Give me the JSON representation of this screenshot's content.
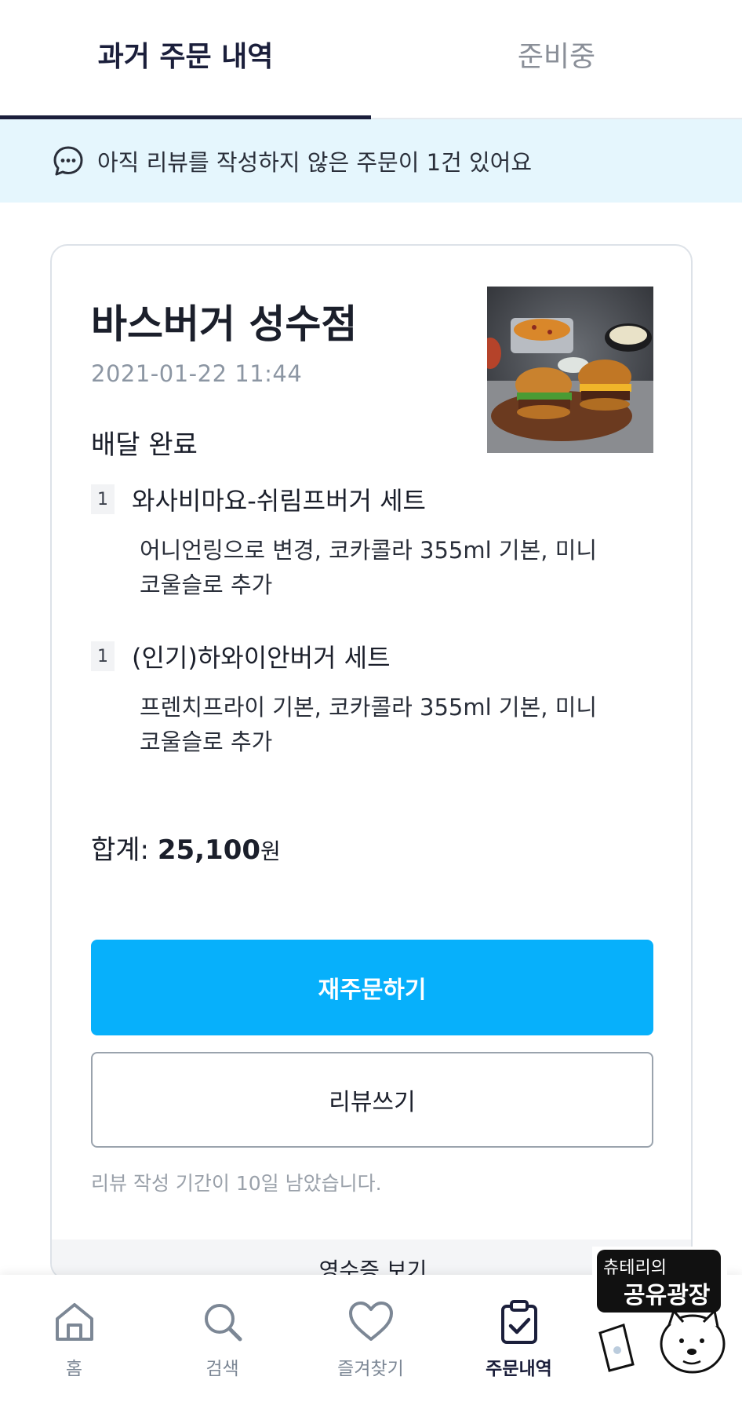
{
  "tabs": [
    {
      "label": "과거 주문 내역",
      "active": true
    },
    {
      "label": "준비중",
      "active": false
    }
  ],
  "notice": {
    "text": "아직 리뷰를 작성하지 않은 주문이 1건 있어요",
    "icon": "chat-bubble-icon"
  },
  "order": {
    "store_name": "바스버거 성수점",
    "date": "2021-01-22 11:44",
    "status": "배달 완료",
    "items": [
      {
        "qty": "1",
        "name": "와사비마요-쉬림프버거 세트",
        "options_line1": "어니언링으로 변경, 코카콜라 355ml 기본, 미니",
        "options_line2": "코울슬로 추가"
      },
      {
        "qty": "1",
        "name": "(인기)하와이안버거 세트",
        "options_line1": "프렌치프라이 기본, 코카콜라 355ml 기본, 미니",
        "options_line2": "코울슬로 추가"
      }
    ],
    "total_label": "합계:",
    "total_amount": "25,100",
    "total_unit": "원",
    "reorder_label": "재주문하기",
    "review_label": "리뷰쓰기",
    "review_period": "리뷰 작성 기간이 10일 남았습니다.",
    "receipt_label": "영수증 보기"
  },
  "nav": [
    {
      "label": "홈",
      "icon": "home-icon",
      "active": false
    },
    {
      "label": "검색",
      "icon": "search-icon",
      "active": false
    },
    {
      "label": "즐겨찾기",
      "icon": "heart-icon",
      "active": false
    },
    {
      "label": "주문내역",
      "icon": "clipboard-check-icon",
      "active": true
    }
  ],
  "watermark": {
    "line1": "츄테리의",
    "line2": "공유광장"
  },
  "colors": {
    "accent": "#07b0fb",
    "notice_bg": "#e5f6fd",
    "active_tab": "#1b1f3b"
  }
}
